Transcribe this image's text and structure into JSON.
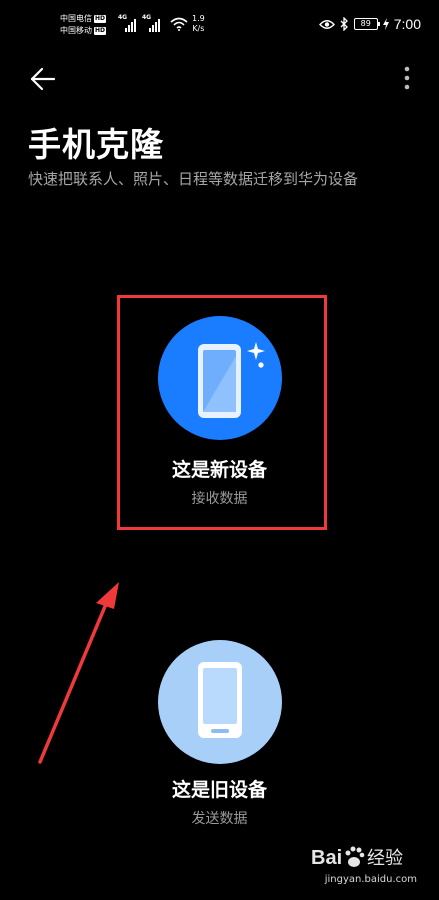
{
  "status_bar": {
    "carrier1": "中国电信",
    "carrier2": "中国移动",
    "hd_badge": "HD",
    "network_gen1": "4G",
    "network_gen2": "4G",
    "net_speed_value": "1.9",
    "net_speed_unit": "K/s",
    "battery": "89",
    "time": "7:00",
    "icons": [
      "wifi-icon",
      "eye-icon",
      "bluetooth-icon",
      "charging-bolt-icon"
    ]
  },
  "app_bar": {
    "back_icon": "arrow-left-icon",
    "more_icon": "more-vertical-icon"
  },
  "header": {
    "title": "手机克隆",
    "subtitle": "快速把联系人、照片、日程等数据迁移到华为设备"
  },
  "options": {
    "new_device": {
      "title": "这是新设备",
      "desc": "接收数据",
      "icon": "phone-sparkle-icon",
      "color": "#1a7dff"
    },
    "old_device": {
      "title": "这是旧设备",
      "desc": "发送数据",
      "icon": "phone-icon",
      "color": "#a8cff8"
    }
  },
  "annotation": {
    "highlight_color": "#f0393a"
  },
  "watermark": {
    "brand_left": "Bai",
    "brand_right": "经验",
    "url": "jingyan.baidu.com"
  }
}
